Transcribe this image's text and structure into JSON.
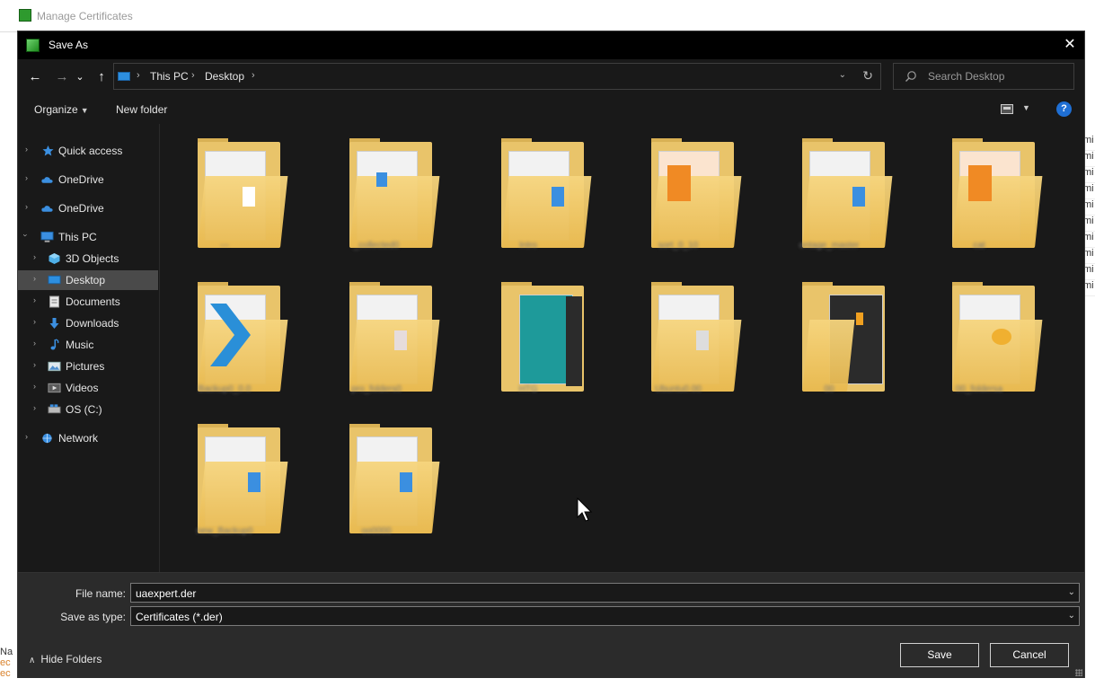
{
  "background_window": {
    "title": "Manage Certificates",
    "right_rows": [
      "mi",
      "mi",
      "mi",
      "mi",
      "mi",
      "mi",
      "mi",
      "mi",
      "mi",
      "mi"
    ],
    "left_bottom": [
      "Na",
      "ec",
      "ec"
    ]
  },
  "dialog": {
    "title": "Save As",
    "close_symbol": "✕"
  },
  "navigation": {
    "back_symbol": "←",
    "forward_symbol": "→",
    "recent_symbol": "⌄",
    "up_symbol": "↑",
    "breadcrumbs": [
      "This PC",
      "Desktop"
    ],
    "refresh_symbol": "↻",
    "search_placeholder": "Search Desktop"
  },
  "toolbar": {
    "organize_label": "Organize",
    "new_folder_label": "New folder",
    "help_symbol": "?"
  },
  "sidebar": {
    "items": [
      {
        "label": "Quick access",
        "icon": "star-icon",
        "color": "#3b8fe0"
      },
      {
        "label": "OneDrive",
        "icon": "cloud-icon",
        "color": "#3b8fe0"
      },
      {
        "label": "OneDrive",
        "icon": "cloud-icon",
        "color": "#3b8fe0"
      },
      {
        "label": "This PC",
        "icon": "computer-icon",
        "color": "#3b8fe0"
      },
      {
        "label": "3D Objects",
        "icon": "cube-icon",
        "color": "#4fb0e8"
      },
      {
        "label": "Desktop",
        "icon": "desktop-icon",
        "color": "#2d8fe0"
      },
      {
        "label": "Documents",
        "icon": "document-icon",
        "color": "#dcdcdc"
      },
      {
        "label": "Downloads",
        "icon": "download-icon",
        "color": "#3b8fe0"
      },
      {
        "label": "Music",
        "icon": "music-icon",
        "color": "#3b8fe0"
      },
      {
        "label": "Pictures",
        "icon": "picture-icon",
        "color": "#bcd0e0"
      },
      {
        "label": "Videos",
        "icon": "video-icon",
        "color": "#7a7a7a"
      },
      {
        "label": "OS (C:)",
        "icon": "drive-icon",
        "color": "#aaaaaa"
      },
      {
        "label": "Network",
        "icon": "network-icon",
        "color": "#3b8fe0"
      }
    ],
    "selected": "Desktop"
  },
  "files": {
    "items": [
      {
        "label": "---",
        "mark_color": "#ffffff"
      },
      {
        "label": "_collected0",
        "mark_color": "#3b8fe0"
      },
      {
        "label": "Intro",
        "mark_color": "#3b8fe0"
      },
      {
        "label": "sort_0_10",
        "mark_color": "#f08a24"
      },
      {
        "label": "ontage_master",
        "mark_color": "#3b8fe0"
      },
      {
        "label": "cat",
        "mark_color": "#f08a24"
      },
      {
        "label": "Backup0_0.0",
        "mark_color": "#2a8fd8"
      },
      {
        "label": "pro_folders0",
        "mark_color": "#dddddd"
      },
      {
        "label": "HTG",
        "mark_color": "#1e9a9a"
      },
      {
        "label": "Ubuntu0.00",
        "mark_color": "#dddddd"
      },
      {
        "label": "00",
        "mark_color": "#f0a020"
      },
      {
        "label": "00_foldersa",
        "mark_color": "#f0b030"
      },
      {
        "label": "new_Backup0",
        "mark_color": "#3b8fe0"
      },
      {
        "label": "oo0000",
        "mark_color": "#3b8fe0"
      }
    ]
  },
  "form": {
    "file_name_label": "File name:",
    "file_name_value": "uaexpert.der",
    "save_type_label": "Save as type:",
    "save_type_value": "Certificates (*.der)",
    "hide_folders_label": "Hide Folders",
    "save_label": "Save",
    "cancel_label": "Cancel"
  }
}
